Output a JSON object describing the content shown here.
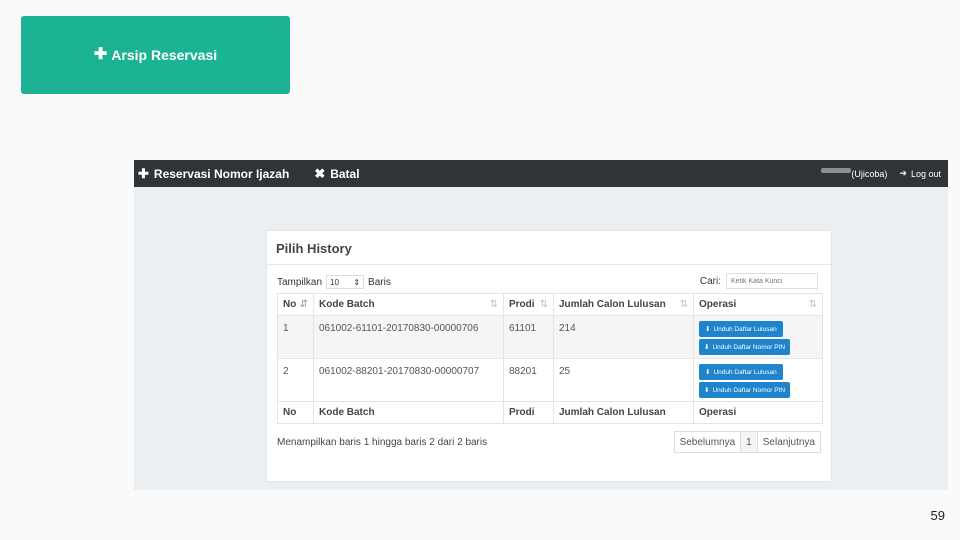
{
  "archive_button": {
    "icon": "plus-icon",
    "label": "Arsip Reservasi"
  },
  "navbar": {
    "reserve_label": "Reservasi Nomor Ijazah",
    "cancel_label": "Batal",
    "user_label": "(Ujicoba)",
    "logout_label": "Log out"
  },
  "panel": {
    "title": "Pilih History",
    "show_label": "Tampilkan",
    "page_size": "10",
    "rows_label": "Baris",
    "search_label": "Cari:",
    "search_placeholder": "Ketik Kata Kunci",
    "columns": [
      "No",
      "Kode Batch",
      "Prodi",
      "Jumlah Calon Lulusan",
      "Operasi"
    ],
    "rows": [
      {
        "no": "1",
        "kode_batch": "061002-61101-20170830-00000706",
        "prodi": "61101",
        "jumlah": "214"
      },
      {
        "no": "2",
        "kode_batch": "061002-88201-20170830-00000707",
        "prodi": "88201",
        "jumlah": "25"
      }
    ],
    "op_download_graduates": "Unduh Daftar Lulusan",
    "op_download_pin": "Unduh Daftar Nomor PIN",
    "info": "Menampilkan baris 1 hingga baris 2 dari 2 baris",
    "pager": {
      "prev": "Sebelumnya",
      "current": "1",
      "next": "Selanjutnya"
    }
  },
  "slide_number": "59",
  "colors": {
    "teal": "#1bb394",
    "navbar": "#2f3438",
    "button_blue": "#1f84cc"
  }
}
